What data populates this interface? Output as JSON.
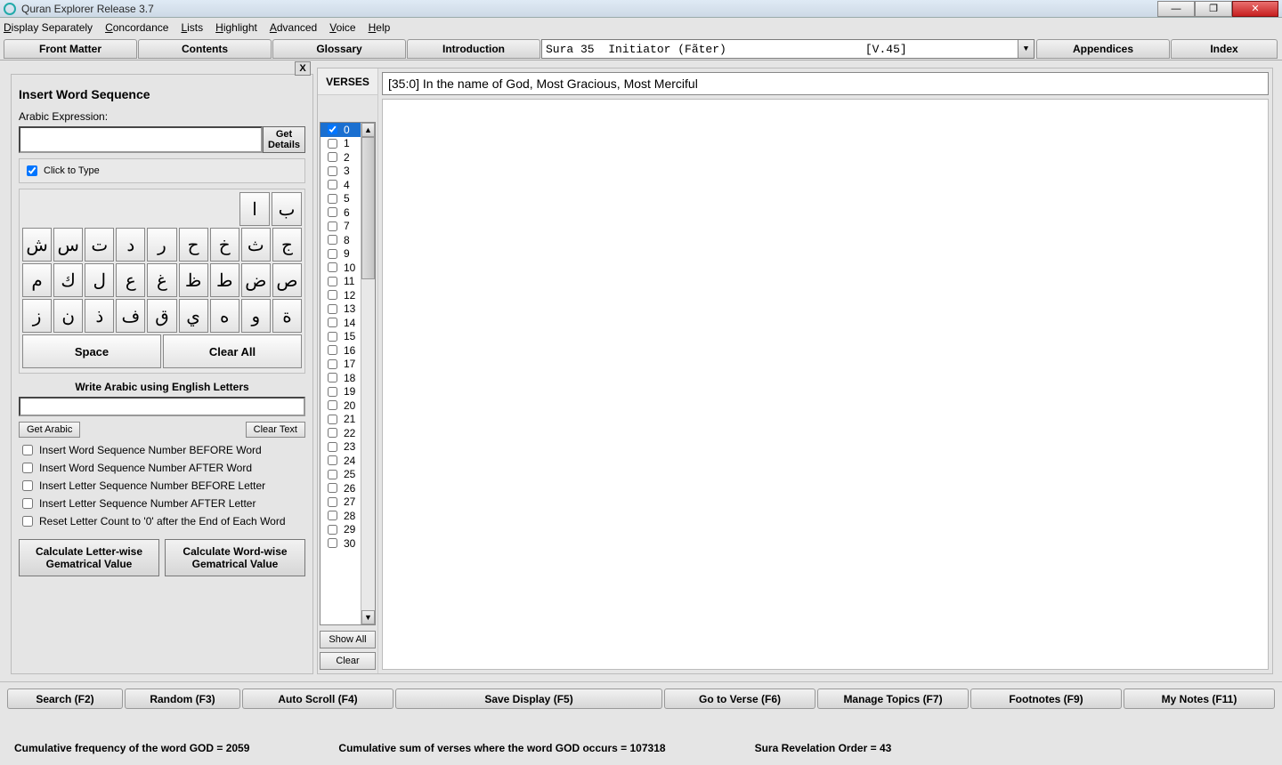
{
  "window": {
    "title": "Quran Explorer Release 3.7"
  },
  "menu": [
    "Display Separately",
    "Concordance",
    "Lists",
    "Highlight",
    "Advanced",
    "Voice",
    "Help"
  ],
  "tabs": {
    "front": "Front Matter",
    "contents": "Contents",
    "glossary": "Glossary",
    "introduction": "Introduction",
    "appendices": "Appendices",
    "index": "Index"
  },
  "sura_select": "Sura 35  Initiator (Fãter)                    [V.45]",
  "sidebar": {
    "title": "Insert Word Sequence",
    "arabic_label": "Arabic Expression:",
    "get_details": "Get Details",
    "click_to_type": "Click to Type",
    "keys_row0": [
      "ا",
      "ب"
    ],
    "keys_row1": [
      "ش",
      "س",
      "ت",
      "د",
      "ر",
      "ح",
      "خ",
      "ث",
      "ج"
    ],
    "keys_row2": [
      "م",
      "ك",
      "ل",
      "ع",
      "غ",
      "ظ",
      "ط",
      "ض",
      "ص"
    ],
    "keys_row3": [
      "ز",
      "ن",
      "ذ",
      "ف",
      "ق",
      "ي",
      "ه",
      "و",
      "ة"
    ],
    "space": "Space",
    "clear_all": "Clear All",
    "eng_head": "Write Arabic using English Letters",
    "get_arabic": "Get Arabic",
    "clear_text": "Clear Text",
    "opts": [
      "Insert Word Sequence Number BEFORE Word",
      "Insert Word Sequence Number AFTER Word",
      "Insert Letter Sequence Number BEFORE Letter",
      "Insert Letter Sequence Number AFTER Letter",
      "Reset Letter Count to '0' after the End of Each Word"
    ],
    "calc_letter": "Calculate Letter-wise Gematrical Value",
    "calc_word": "Calculate Word-wise Gematrical Value"
  },
  "verses": {
    "header": "VERSES",
    "text": "[35:0] In the name of God, Most Gracious, Most Merciful",
    "list": [
      "0",
      "1",
      "2",
      "3",
      "4",
      "5",
      "6",
      "7",
      "8",
      "9",
      "10",
      "11",
      "12",
      "13",
      "14",
      "15",
      "16",
      "17",
      "18",
      "19",
      "20",
      "21",
      "22",
      "23",
      "24",
      "25",
      "26",
      "27",
      "28",
      "29",
      "30"
    ],
    "selected": 0,
    "show_all": "Show All",
    "clear": "Clear"
  },
  "bottom": {
    "search": "Search (F2)",
    "random": "Random (F3)",
    "autoscroll": "Auto Scroll (F4)",
    "save": "Save Display (F5)",
    "goto": "Go to Verse (F6)",
    "topics": "Manage Topics (F7)",
    "footnotes": "Footnotes (F9)",
    "notes": "My Notes (F11)"
  },
  "status": {
    "freq": "Cumulative frequency of the word GOD = 2059",
    "sum": "Cumulative sum of verses where the word GOD occurs = 107318",
    "order": "Sura Revelation Order = 43"
  }
}
